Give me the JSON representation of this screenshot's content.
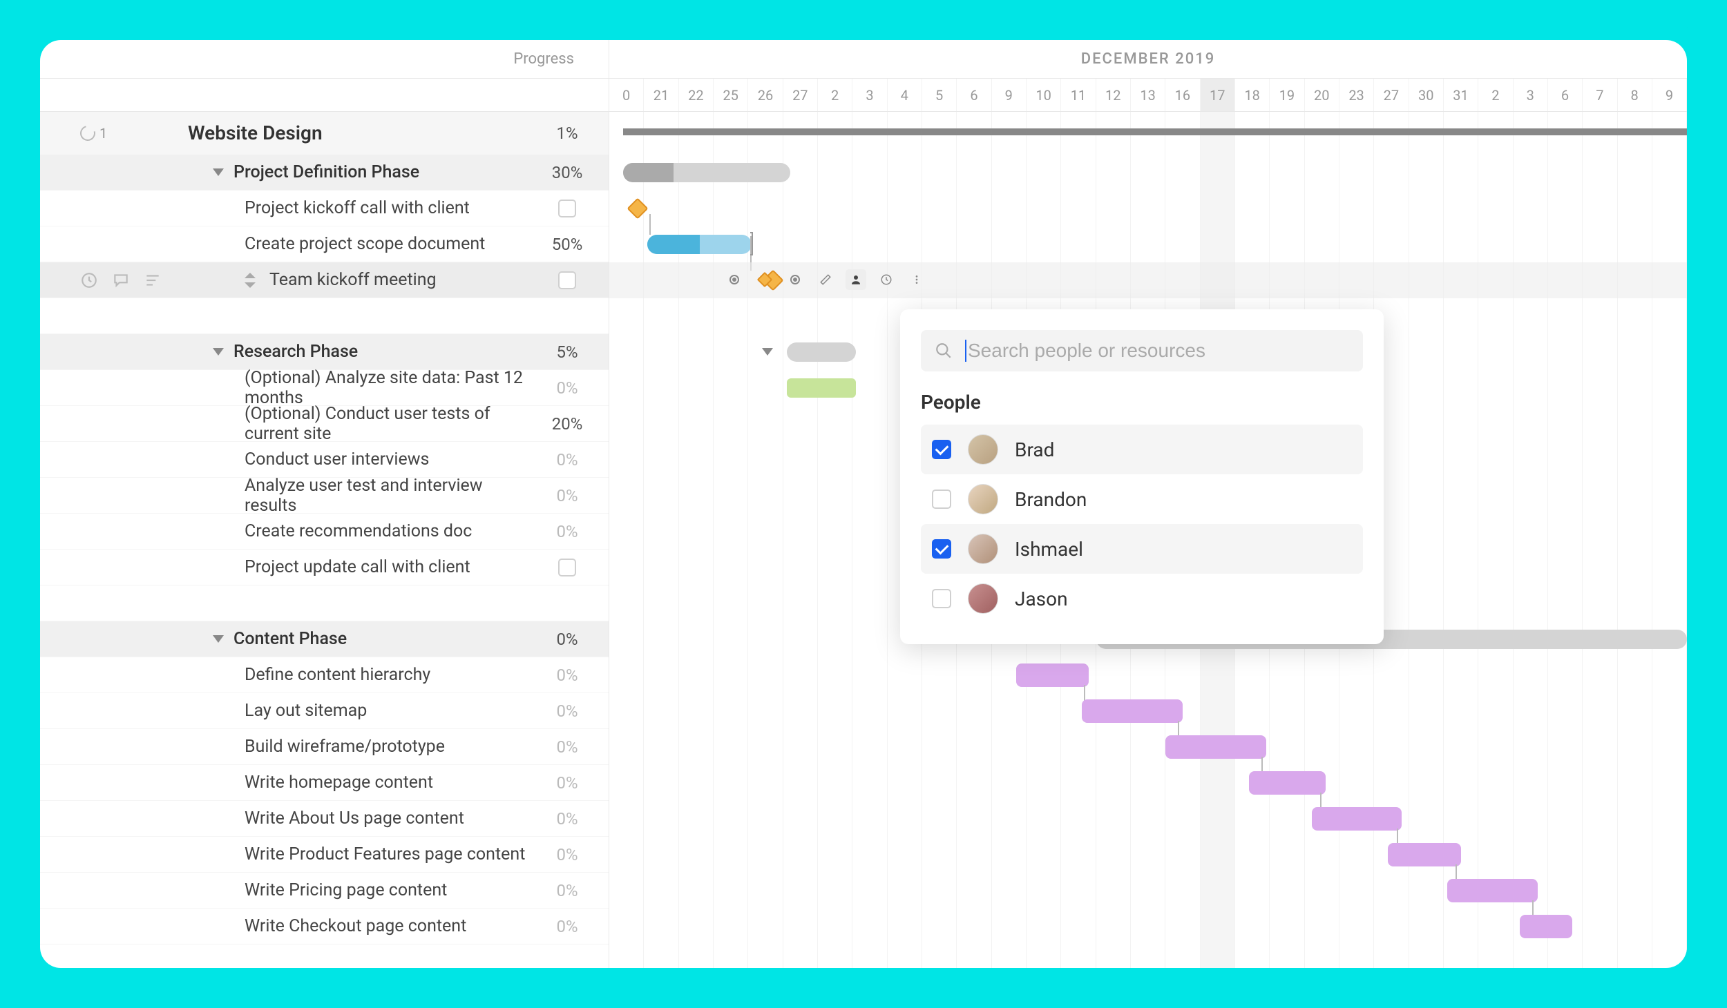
{
  "header": {
    "progress_label": "Progress",
    "month_label": "DECEMBER 2019"
  },
  "dates": [
    "0",
    "21",
    "22",
    "25",
    "26",
    "27",
    "2",
    "3",
    "4",
    "5",
    "6",
    "9",
    "10",
    "11",
    "12",
    "13",
    "16",
    "17",
    "18",
    "19",
    "20",
    "23",
    "27",
    "30",
    "31",
    "2",
    "3",
    "6",
    "7",
    "8",
    "9"
  ],
  "highlight_date_index": 17,
  "project": {
    "badge_count": "1",
    "title": "Website Design",
    "progress": "1%"
  },
  "phases": [
    {
      "name": "Project Definition Phase",
      "progress": "30%",
      "tasks": [
        {
          "name": "Project kickoff call with client",
          "progress": "",
          "checkbox": true
        },
        {
          "name": "Create project scope document",
          "progress": "50%"
        },
        {
          "name": "Team kickoff meeting",
          "progress": "",
          "checkbox": true,
          "selected": true
        }
      ]
    },
    {
      "name": "Research Phase",
      "progress": "5%",
      "tasks": [
        {
          "name": "(Optional) Analyze site data: Past 12 months",
          "progress": "0%"
        },
        {
          "name": "(Optional) Conduct user tests of current site",
          "progress": "20%"
        },
        {
          "name": "Conduct user interviews",
          "progress": "0%"
        },
        {
          "name": "Analyze user test and interview results",
          "progress": "0%"
        },
        {
          "name": "Create recommendations doc",
          "progress": "0%"
        },
        {
          "name": "Project update call with client",
          "progress": "",
          "checkbox": true
        }
      ]
    },
    {
      "name": "Content Phase",
      "progress": "0%",
      "tasks": [
        {
          "name": "Define content hierarchy",
          "progress": "0%"
        },
        {
          "name": "Lay out sitemap",
          "progress": "0%"
        },
        {
          "name": "Build wireframe/prototype",
          "progress": "0%"
        },
        {
          "name": "Write homepage content",
          "progress": "0%"
        },
        {
          "name": "Write About Us page content",
          "progress": "0%"
        },
        {
          "name": "Write Product Features page content",
          "progress": "0%"
        },
        {
          "name": "Write Pricing page content",
          "progress": "0%"
        },
        {
          "name": "Write Checkout page content",
          "progress": "0%"
        }
      ]
    }
  ],
  "popover": {
    "search_placeholder": "Search people or resources",
    "section_label": "People",
    "people": [
      {
        "name": "Brad",
        "checked": true
      },
      {
        "name": "Brandon",
        "checked": false
      },
      {
        "name": "Ishmael",
        "checked": true
      },
      {
        "name": "Jason",
        "checked": false
      }
    ]
  }
}
